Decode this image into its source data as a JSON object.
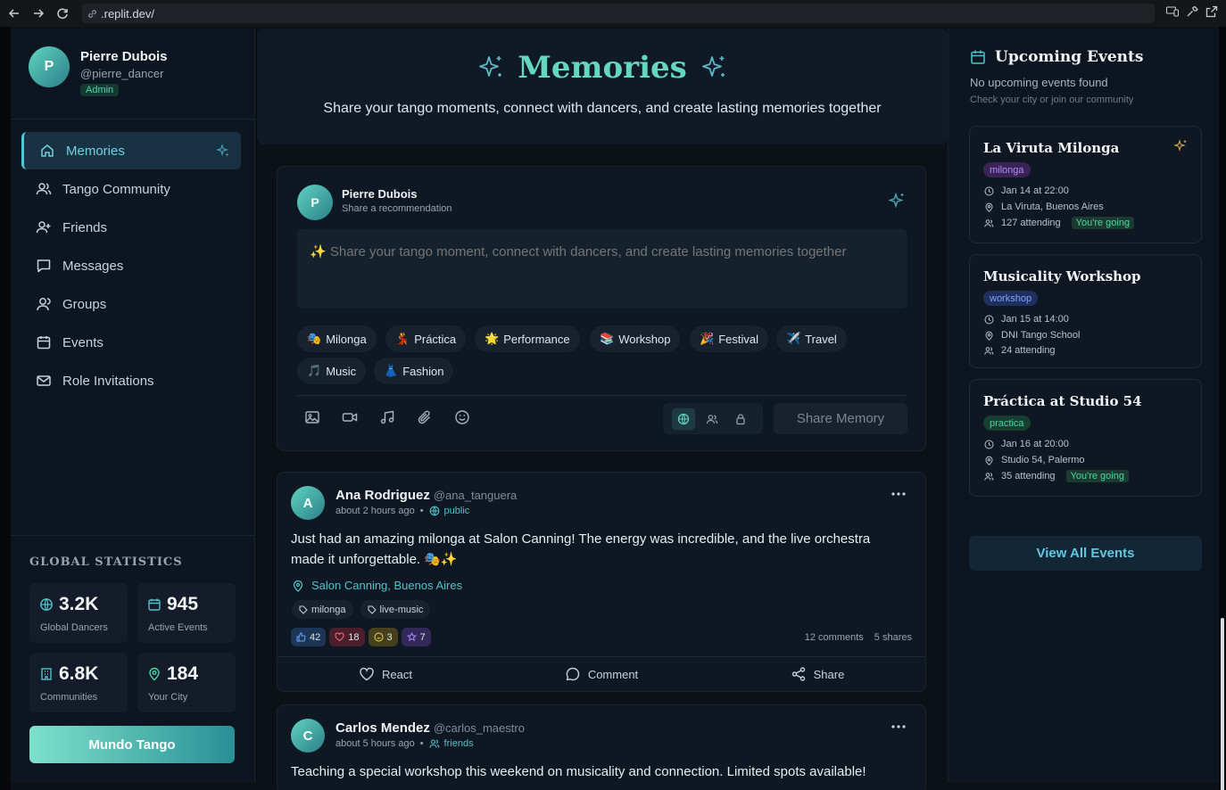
{
  "browser": {
    "url": ".replit.dev/"
  },
  "user": {
    "initial": "P",
    "name": "Pierre Dubois",
    "handle": "@pierre_dancer",
    "role": "Admin"
  },
  "sidebar": {
    "items": [
      {
        "label": "Memories",
        "icon": "home-icon",
        "active": true
      },
      {
        "label": "Tango Community",
        "icon": "users-icon"
      },
      {
        "label": "Friends",
        "icon": "user-plus-icon"
      },
      {
        "label": "Messages",
        "icon": "message-icon"
      },
      {
        "label": "Groups",
        "icon": "group-icon"
      },
      {
        "label": "Events",
        "icon": "calendar-icon"
      },
      {
        "label": "Role Invitations",
        "icon": "mail-icon"
      }
    ]
  },
  "stats": {
    "title": "GLOBAL STATISTICS",
    "items": [
      {
        "value": "3.2K",
        "label": "Global Dancers",
        "icon": "globe-icon"
      },
      {
        "value": "945",
        "label": "Active Events",
        "icon": "calendar-icon"
      },
      {
        "value": "6.8K",
        "label": "Communities",
        "icon": "building-icon"
      },
      {
        "value": "184",
        "label": "Your City",
        "icon": "pin-icon"
      }
    ],
    "button": "Mundo Tango"
  },
  "hero": {
    "title": "Memories",
    "subtitle": "Share your tango moments, connect with dancers, and create lasting memories together"
  },
  "composer": {
    "name": "Pierre Dubois",
    "subtitle": "Share a recommendation",
    "placeholder": "✨ Share your tango moment, connect with dancers, and create lasting memories together",
    "chips": [
      {
        "emoji": "🎭",
        "label": "Milonga"
      },
      {
        "emoji": "💃",
        "label": "Práctica"
      },
      {
        "emoji": "🌟",
        "label": "Performance"
      },
      {
        "emoji": "📚",
        "label": "Workshop"
      },
      {
        "emoji": "🎉",
        "label": "Festival"
      },
      {
        "emoji": "✈️",
        "label": "Travel"
      },
      {
        "emoji": "🎵",
        "label": "Music"
      },
      {
        "emoji": "👗",
        "label": "Fashion"
      }
    ],
    "submit": "Share Memory"
  },
  "posts": [
    {
      "initial": "A",
      "name": "Ana Rodriguez",
      "handle": "@ana_tanguera",
      "time": "about 2 hours ago",
      "visibility": "public",
      "body": "Just had an amazing milonga at Salon Canning! The energy was incredible, and the live orchestra made it unforgettable. 🎭✨",
      "location": "Salon Canning, Buenos Aires",
      "tags": [
        "milonga",
        "live-music"
      ],
      "reactions": {
        "like": "42",
        "heart": "18",
        "laugh": "3",
        "star": "7"
      },
      "comments": "12 comments",
      "shares": "5 shares",
      "actions": {
        "react": "React",
        "comment": "Comment",
        "share": "Share"
      }
    },
    {
      "initial": "C",
      "name": "Carlos Mendez",
      "handle": "@carlos_maestro",
      "time": "about 5 hours ago",
      "visibility": "friends",
      "body": "Teaching a special workshop this weekend on musicality and connection. Limited spots available!"
    }
  ],
  "events": {
    "title": "Upcoming Events",
    "empty": "No upcoming events found",
    "hint": "Check your city or join our community",
    "items": [
      {
        "name": "La Viruta Milonga",
        "type": "milonga",
        "date": "Jan 14 at 22:00",
        "place": "La Viruta, Buenos Aires",
        "attending": "127 attending",
        "going": "You're going"
      },
      {
        "name": "Musicality Workshop",
        "type": "workshop",
        "date": "Jan 15 at 14:00",
        "place": "DNI Tango School",
        "attending": "24 attending",
        "going": ""
      },
      {
        "name": "Práctica at Studio 54",
        "type": "practica",
        "date": "Jan 16 at 20:00",
        "place": "Studio 54, Palermo",
        "attending": "35 attending",
        "going": "You're going"
      }
    ],
    "view_all": "View All Events"
  },
  "colors": {
    "accent": "#63d7bf",
    "link": "#4fc3c9",
    "background": "#0c1118"
  }
}
